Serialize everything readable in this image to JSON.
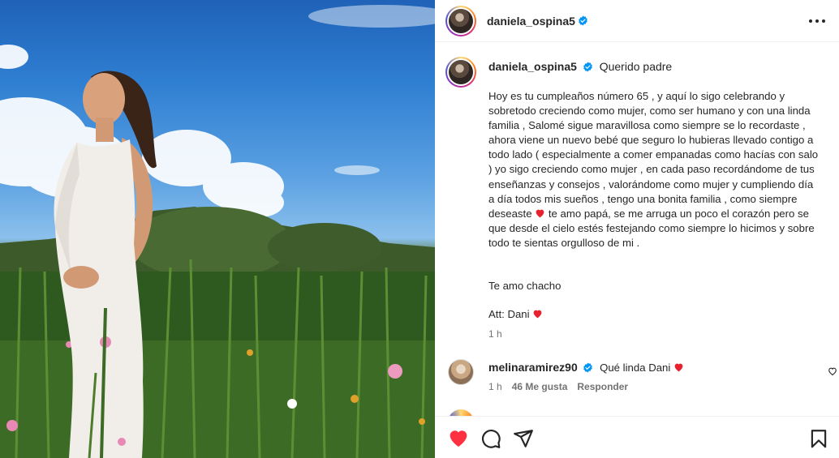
{
  "post": {
    "username": "daniela_ospina5",
    "verified": true,
    "caption_title": "Querido padre",
    "caption_body": "Hoy es tu cumpleaños número 65 , y aquí lo sigo celebrando y sobretodo creciendo como mujer, como ser humano y con una linda familia , Salomé sigue maravillosa como siempre se lo recordaste , ahora viene un nuevo bebé que seguro lo hubieras llevado contigo a todo lado ( especialmente a comer empanadas como hacías con salo ) yo sigo creciendo como mujer , en cada paso recordándome de tus enseñanzas y consejos , valorándome como mujer y cumpliendo día a día todos mis sueños , tengo una bonita familia , como siempre deseaste",
    "caption_body_after_heart": " te amo papá, se me arruga un poco el corazón pero se que desde el cielo estés festejando como siempre lo hicimos y sobre todo te sientas orgulloso de mi .",
    "caption_p2": "Te amo chacho",
    "caption_p3": "Att: Dani",
    "caption_time": "1 h"
  },
  "comment": {
    "username": "melinaramirez90",
    "verified": true,
    "text": "Qué linda Dani",
    "time": "1 h",
    "likes": "46 Me gusta",
    "reply": "Responder"
  },
  "icons": {
    "more": "more-options-icon",
    "verified": "verified-badge-icon",
    "heart_filled": "heart-filled-icon",
    "comment": "comment-icon",
    "share": "share-icon",
    "save": "bookmark-icon",
    "comment_like": "heart-outline-icon"
  },
  "colors": {
    "verified": "#0095f6",
    "heart": "#ff3040",
    "text": "#262626",
    "secondary": "#737373"
  }
}
